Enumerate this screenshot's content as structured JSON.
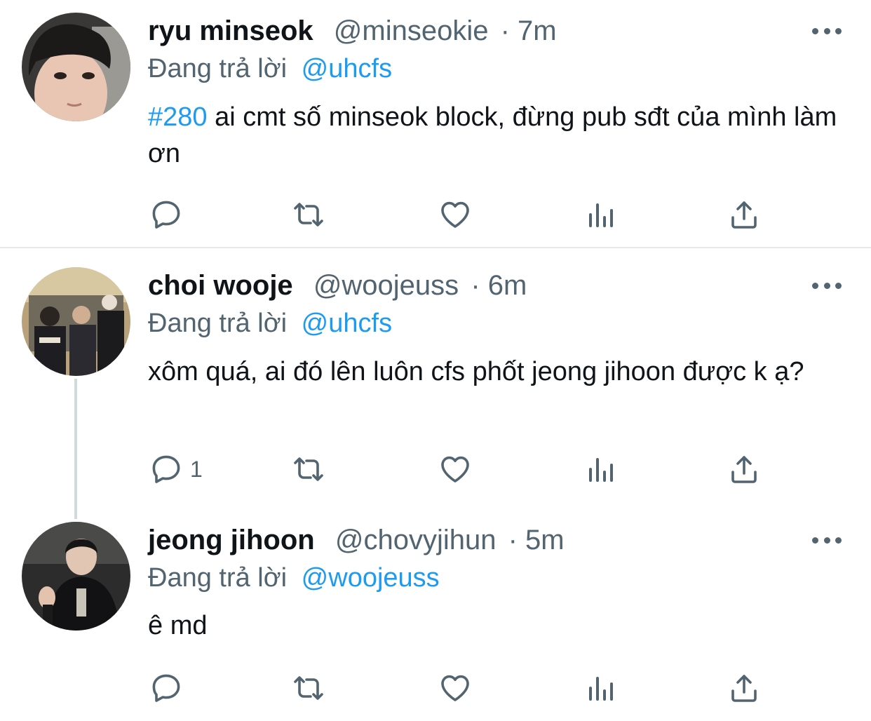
{
  "tweets": [
    {
      "name": "ryu minseok",
      "handle": "@minseokie",
      "time": "· 7m",
      "reply_prefix": "Đang trả lời",
      "reply_to": "@uhcfs",
      "hashtag": "#280",
      "text": " ai cmt số minseok block, đừng pub sđt của mình làm ơn",
      "reply_count": ""
    },
    {
      "name": "choi wooje",
      "handle": "@woojeuss",
      "time": "· 6m",
      "reply_prefix": "Đang trả lời",
      "reply_to": "@uhcfs",
      "text": "xôm quá, ai đó lên luôn cfs phốt jeong jihoon được k ạ?",
      "reply_count": "1"
    },
    {
      "name": "jeong jihoon",
      "handle": "@chovyjihun",
      "time": "· 5m",
      "reply_prefix": "Đang trả lời",
      "reply_to": "@woojeuss",
      "text": "ê md",
      "reply_count": ""
    }
  ],
  "icons": {
    "reply": "reply-icon",
    "retweet": "retweet-icon",
    "like": "heart-icon",
    "views": "views-icon",
    "share": "share-icon",
    "more": "more-icon"
  },
  "colors": {
    "accent": "#1d9bf0",
    "secondary_text": "#536471",
    "primary_text": "#0f1419",
    "divider": "#e6e9eb"
  }
}
